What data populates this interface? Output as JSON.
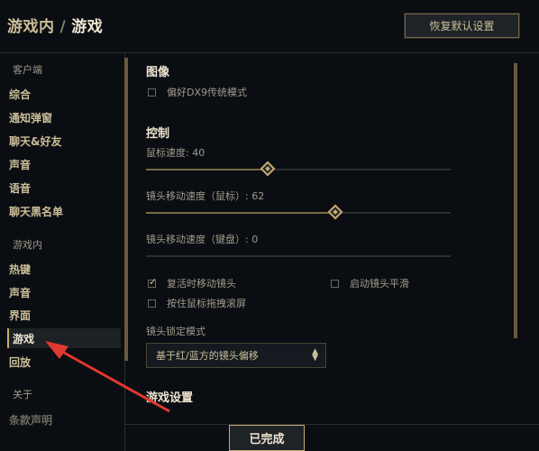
{
  "header": {
    "breadcrumb_parent": "游戏内",
    "breadcrumb_sep": "/",
    "breadcrumb_current": "游戏",
    "reset_label": "恢复默认设置"
  },
  "sidebar": {
    "sections": [
      {
        "title": "客户端",
        "items": [
          "综合",
          "通知弹窗",
          "聊天&好友",
          "声音",
          "语音",
          "聊天黑名单"
        ]
      },
      {
        "title": "游戏内",
        "items": [
          "热键",
          "声音",
          "界面",
          "游戏",
          "回放"
        ]
      },
      {
        "title": "关于",
        "items": [
          "条款声明"
        ]
      }
    ],
    "active_item": "游戏"
  },
  "main": {
    "image_section": {
      "title": "图像",
      "dx9_label": "偏好DX9传统模式",
      "dx9_checked": false
    },
    "control_section": {
      "title": "控制",
      "mouse_speed_label": "鼠标速度: 40",
      "mouse_speed_value": 40,
      "cam_speed_mouse_label": "镜头移动速度（鼠标）: 62",
      "cam_speed_mouse_value": 62,
      "cam_speed_keyboard_label": "镜头移动速度（键盘）: 0",
      "cam_speed_keyboard_value": 0,
      "move_cam_on_revive_label": "复活时移动镜头",
      "move_cam_on_revive_checked": true,
      "smooth_cam_label": "启动镜头平滑",
      "smooth_cam_checked": false,
      "drag_scroll_label": "按住鼠标拖拽滚屏",
      "drag_scroll_checked": false,
      "cam_lock_mode_label": "镜头锁定模式",
      "cam_lock_mode_value": "基于红/蓝方的镜头偏移"
    },
    "game_settings_title": "游戏设置"
  },
  "footer": {
    "done_label": "已完成"
  },
  "colors": {
    "gold": "#c8aa6e",
    "background": "#0a0d12",
    "annotation_arrow": "#e0392f"
  }
}
